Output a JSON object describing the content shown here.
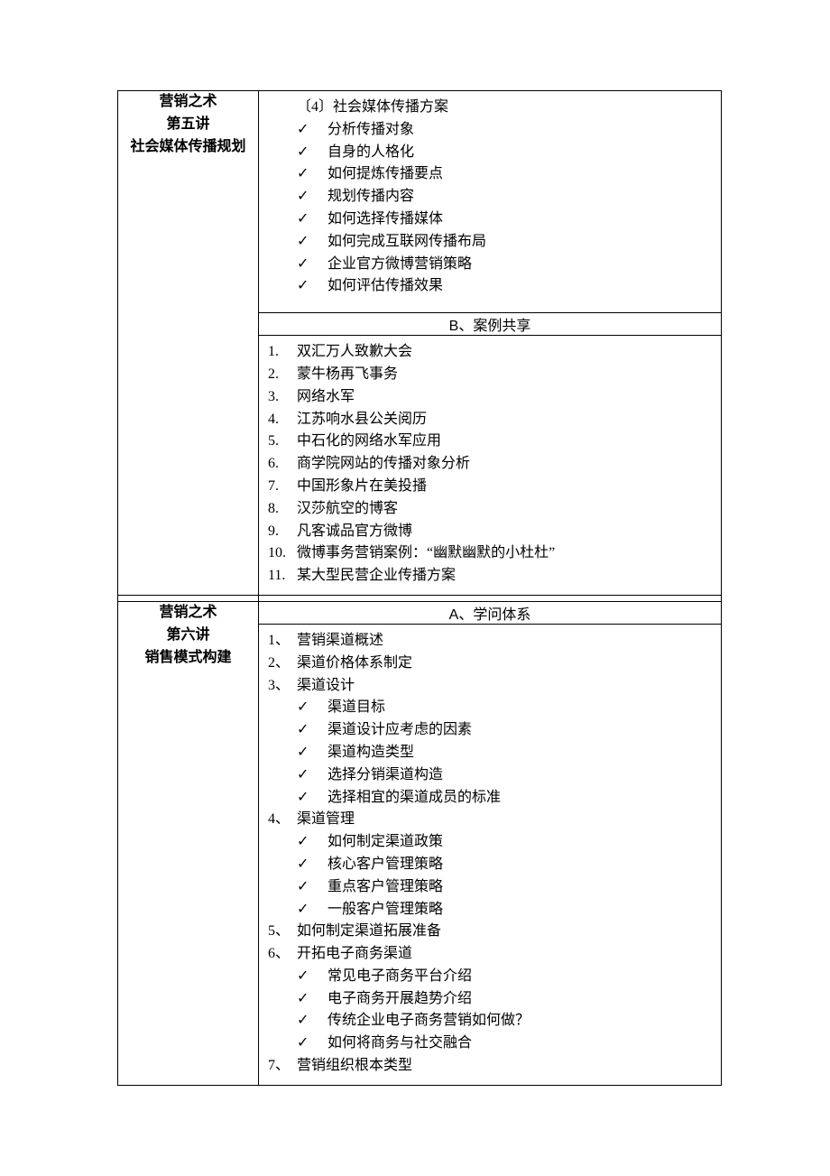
{
  "lecture5": {
    "left": [
      "营销之术",
      "第五讲",
      "社会媒体传播规划"
    ],
    "top_title": "〔4〕社会媒体传播方案",
    "top_checks": [
      "分析传播对象",
      "自身的人格化",
      "如何提炼传播要点",
      "规划传播内容",
      "如何选择传播媒体",
      "如何完成互联网传播布局",
      "企业官方微博营销策略",
      "如何评估传播效果"
    ],
    "sectionB": "B、案例共享",
    "cases": [
      "双汇万人致歉大会",
      "蒙牛杨再飞事务",
      "网络水军",
      "江苏响水县公关阅历",
      "中石化的网络水军应用",
      "商学院网站的传播对象分析",
      "中国形象片在美投播",
      "汉莎航空的博客",
      "凡客诚品官方微博",
      "微博事务营销案例：“幽默幽默的小杜杜”",
      "某大型民营企业传播方案"
    ]
  },
  "lecture6": {
    "left": [
      "营销之术",
      "第六讲",
      "销售模式构建"
    ],
    "sectionA": "A、学问体系",
    "items": {
      "n1": "营销渠道概述",
      "n2": "渠道价格体系制定",
      "n3": "渠道设计",
      "n3_checks": [
        "渠道目标",
        "渠道设计应考虑的因素",
        "渠道构造类型",
        "选择分销渠道构造",
        "选择相宜的渠道成员的标准"
      ],
      "n4": "渠道管理",
      "n4_checks": [
        "如何制定渠道政策",
        "核心客户管理策略",
        "重点客户管理策略",
        "一般客户管理策略"
      ],
      "n5": "如何制定渠道拓展准备",
      "n6": "开拓电子商务渠道",
      "n6_checks": [
        "常见电子商务平台介绍",
        "电子商务开展趋势介绍",
        "传统企业电子商务营销如何做？",
        "如何将商务与社交融合"
      ],
      "n7": "营销组织根本类型"
    }
  }
}
